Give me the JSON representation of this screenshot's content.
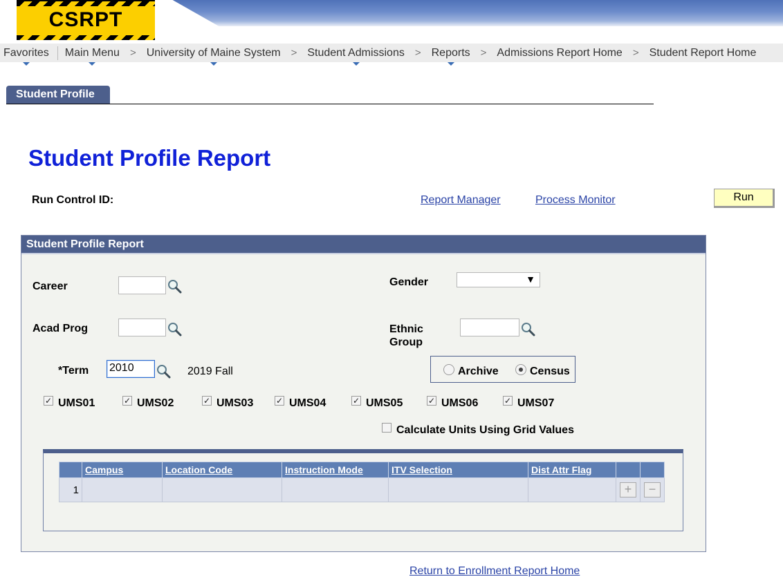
{
  "header": {
    "logo_text": "CSRPT"
  },
  "breadcrumb": [
    {
      "label": "Favorites",
      "dropdown": true
    },
    {
      "label": "Main Menu",
      "dropdown": true
    },
    {
      "label": "University of Maine System",
      "dropdown": true
    },
    {
      "label": "Student Admissions",
      "dropdown": true
    },
    {
      "label": "Reports",
      "dropdown": true
    },
    {
      "label": "Admissions Report Home",
      "dropdown": false
    },
    {
      "label": "Student Report Home",
      "dropdown": false
    }
  ],
  "tab": {
    "label": "Student Profile"
  },
  "page": {
    "title": "Student Profile Report",
    "run_control_label": "Run Control ID:",
    "report_manager_link": "Report Manager",
    "process_monitor_link": "Process Monitor",
    "run_button": "Run",
    "return_link": "Return to Enrollment Report Home"
  },
  "group": {
    "title": "Student Profile Report",
    "career_label": "Career",
    "career_value": "",
    "acad_prog_label": "Acad Prog",
    "acad_prog_value": "",
    "gender_label": "Gender",
    "gender_value": "",
    "ethnic_label_line1": "Ethnic",
    "ethnic_label_line2": "Group",
    "ethnic_value": "",
    "term_label": "*Term",
    "term_value": "2010",
    "term_desc": "2019 Fall",
    "archive_label": "Archive",
    "census_label": "Census",
    "selected_option": "Census",
    "campuses": [
      {
        "label": "UMS01",
        "checked": true
      },
      {
        "label": "UMS02",
        "checked": true
      },
      {
        "label": "UMS03",
        "checked": true
      },
      {
        "label": "UMS04",
        "checked": true
      },
      {
        "label": "UMS05",
        "checked": true
      },
      {
        "label": "UMS06",
        "checked": true
      },
      {
        "label": "UMS07",
        "checked": true
      }
    ],
    "calc_units_label": "Calculate Units Using Grid Values",
    "calc_units_checked": false
  },
  "grid": {
    "columns": [
      "Campus",
      "Location Code",
      "Instruction Mode",
      "ITV Selection",
      "Dist Attr Flag"
    ],
    "rows": [
      {
        "num": "1",
        "campus": "",
        "location": "",
        "mode": "",
        "itv": "",
        "dist": ""
      }
    ]
  },
  "icons": {
    "lookup": "magnifier-icon",
    "dropdown": "chevron-down-icon",
    "add_row": "plus-icon",
    "delete_row": "minus-icon"
  },
  "colors": {
    "title": "#1021d8",
    "header_bar": "#4d5f8c",
    "grid_header": "#5e7fb4",
    "run_button": "#ffffc0",
    "link": "#2a43a6"
  }
}
